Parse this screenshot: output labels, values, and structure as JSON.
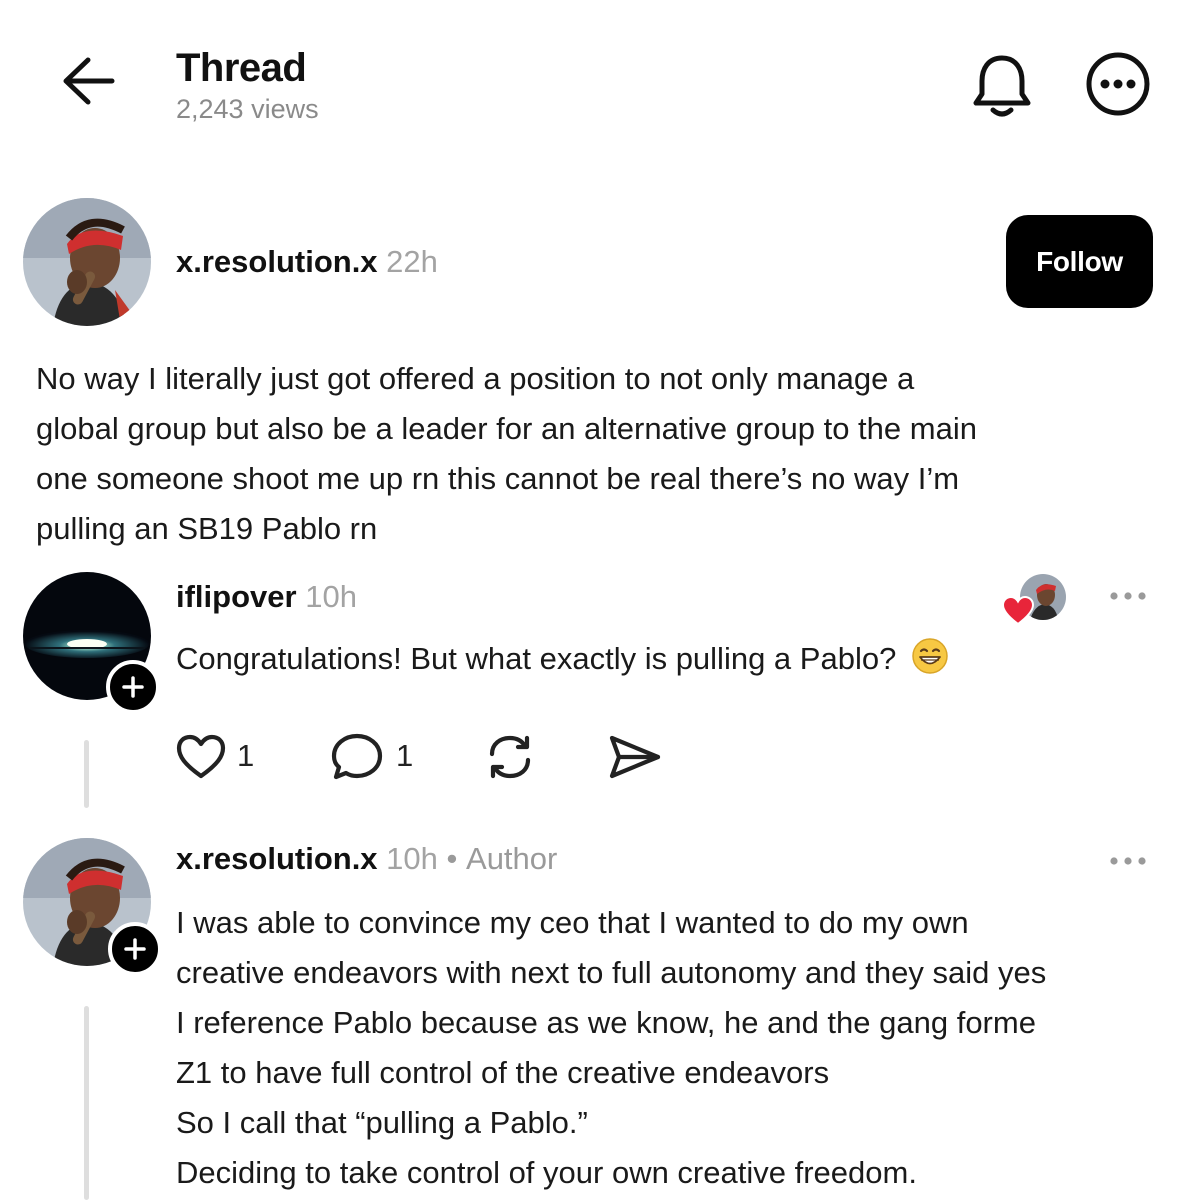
{
  "header": {
    "title": "Thread",
    "views": "2,243 views",
    "back_icon": "arrow-left-icon",
    "bell_icon": "bell-icon",
    "more_icon": "more-circle-icon"
  },
  "original_post": {
    "username": "x.resolution.x",
    "time": "22h",
    "follow_label": "Follow",
    "text_lines": [
      "No way I literally just got offered a position to not only manage a",
      "global group but also be a leader for an alternative group to the main",
      "one someone shoot me up rn this cannot be real there’s no way I’m",
      "pulling an SB19 Pablo rn"
    ]
  },
  "reply_1": {
    "username": "iflipover",
    "time": "10h",
    "text": "Congratulations! But what exactly is pulling a Pablo?",
    "emoji": "😁",
    "like_count": "1",
    "reply_count": "1"
  },
  "reply_2": {
    "username": "x.resolution.x",
    "time": "10h",
    "separator": "•",
    "author_label": "Author",
    "text_lines": [
      "I was able to convince my ceo that I wanted to do my own",
      "creative endeavors with next to full autonomy and they said yes",
      "I reference Pablo because as we know, he and the gang forme",
      "Z1 to have full control of the creative endeavors",
      "So I call that “pulling a Pablo.”",
      "Deciding to take control of your own creative freedom."
    ]
  },
  "colors": {
    "accent_heart": "#e8253a",
    "muted_text": "#9a9a9a",
    "button_bg": "#000000"
  }
}
